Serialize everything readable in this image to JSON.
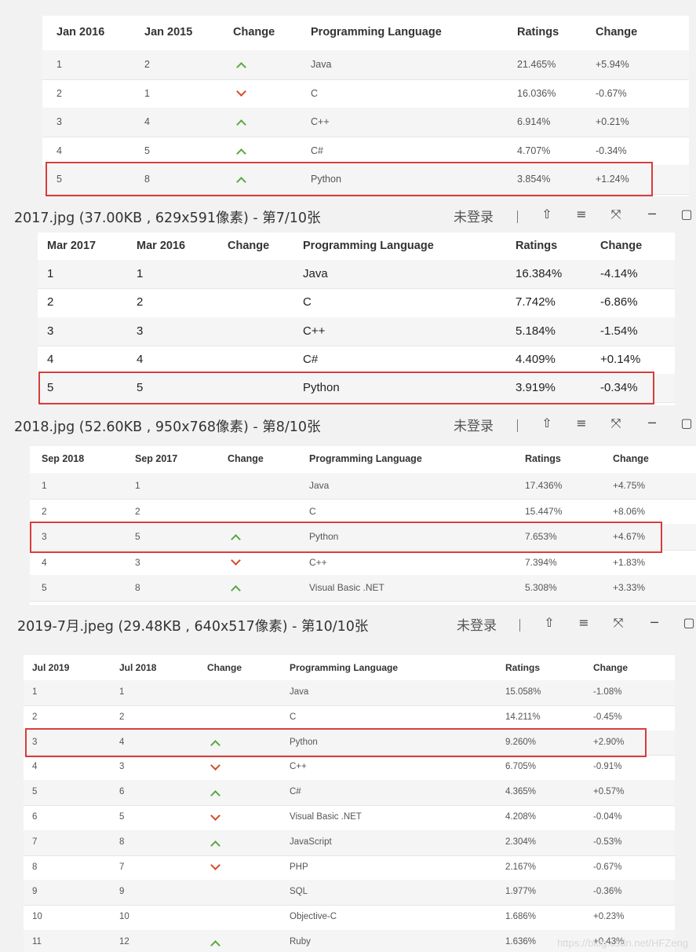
{
  "windows": [
    {
      "title": null,
      "table": {
        "headers": [
          "Jan 2016",
          "Jan 2015",
          "Change",
          "Programming Language",
          "Ratings",
          "Change"
        ],
        "rows": [
          {
            "rank": "1",
            "prev": "2",
            "trend": "up",
            "lang": "Java",
            "rating": "21.465%",
            "change": "+5.94%"
          },
          {
            "rank": "2",
            "prev": "1",
            "trend": "down",
            "lang": "C",
            "rating": "16.036%",
            "change": "-0.67%"
          },
          {
            "rank": "3",
            "prev": "4",
            "trend": "up",
            "lang": "C++",
            "rating": "6.914%",
            "change": "+0.21%"
          },
          {
            "rank": "4",
            "prev": "5",
            "trend": "up",
            "lang": "C#",
            "rating": "4.707%",
            "change": "-0.34%"
          },
          {
            "rank": "5",
            "prev": "8",
            "trend": "up",
            "lang": "Python",
            "rating": "3.854%",
            "change": "+1.24%"
          }
        ],
        "highlighted_row": 4
      }
    },
    {
      "title": "2017.jpg (37.00KB , 629x591像素) - 第7/10张",
      "login": "未登录",
      "table": {
        "headers": [
          "Mar 2017",
          "Mar 2016",
          "Change",
          "Programming Language",
          "Ratings",
          "Change"
        ],
        "rows": [
          {
            "rank": "1",
            "prev": "1",
            "trend": "",
            "lang": "Java",
            "rating": "16.384%",
            "change": "-4.14%"
          },
          {
            "rank": "2",
            "prev": "2",
            "trend": "",
            "lang": "C",
            "rating": "7.742%",
            "change": "-6.86%"
          },
          {
            "rank": "3",
            "prev": "3",
            "trend": "",
            "lang": "C++",
            "rating": "5.184%",
            "change": "-1.54%"
          },
          {
            "rank": "4",
            "prev": "4",
            "trend": "",
            "lang": "C#",
            "rating": "4.409%",
            "change": "+0.14%"
          },
          {
            "rank": "5",
            "prev": "5",
            "trend": "",
            "lang": "Python",
            "rating": "3.919%",
            "change": "-0.34%"
          }
        ],
        "highlighted_row": 4
      }
    },
    {
      "title": "2018.jpg (52.60KB , 950x768像素) - 第8/10张",
      "login": "未登录",
      "table": {
        "headers": [
          "Sep 2018",
          "Sep 2017",
          "Change",
          "Programming Language",
          "Ratings",
          "Change"
        ],
        "rows": [
          {
            "rank": "1",
            "prev": "1",
            "trend": "",
            "lang": "Java",
            "rating": "17.436%",
            "change": "+4.75%"
          },
          {
            "rank": "2",
            "prev": "2",
            "trend": "",
            "lang": "C",
            "rating": "15.447%",
            "change": "+8.06%"
          },
          {
            "rank": "3",
            "prev": "5",
            "trend": "up",
            "lang": "Python",
            "rating": "7.653%",
            "change": "+4.67%"
          },
          {
            "rank": "4",
            "prev": "3",
            "trend": "down",
            "lang": "C++",
            "rating": "7.394%",
            "change": "+1.83%"
          },
          {
            "rank": "5",
            "prev": "8",
            "trend": "up",
            "lang": "Visual Basic .NET",
            "rating": "5.308%",
            "change": "+3.33%"
          }
        ],
        "highlighted_row": 2
      }
    },
    {
      "title": "2019-7月.jpeg (29.48KB , 640x517像素) - 第10/10张",
      "login": "未登录",
      "table": {
        "headers": [
          "Jul 2019",
          "Jul 2018",
          "Change",
          "Programming Language",
          "Ratings",
          "Change"
        ],
        "rows": [
          {
            "rank": "1",
            "prev": "1",
            "trend": "",
            "lang": "Java",
            "rating": "15.058%",
            "change": "-1.08%"
          },
          {
            "rank": "2",
            "prev": "2",
            "trend": "",
            "lang": "C",
            "rating": "14.211%",
            "change": "-0.45%"
          },
          {
            "rank": "3",
            "prev": "4",
            "trend": "up",
            "lang": "Python",
            "rating": "9.260%",
            "change": "+2.90%"
          },
          {
            "rank": "4",
            "prev": "3",
            "trend": "down",
            "lang": "C++",
            "rating": "6.705%",
            "change": "-0.91%"
          },
          {
            "rank": "5",
            "prev": "6",
            "trend": "up",
            "lang": "C#",
            "rating": "4.365%",
            "change": "+0.57%"
          },
          {
            "rank": "6",
            "prev": "5",
            "trend": "down",
            "lang": "Visual Basic .NET",
            "rating": "4.208%",
            "change": "-0.04%"
          },
          {
            "rank": "7",
            "prev": "8",
            "trend": "up",
            "lang": "JavaScript",
            "rating": "2.304%",
            "change": "-0.53%"
          },
          {
            "rank": "8",
            "prev": "7",
            "trend": "down",
            "lang": "PHP",
            "rating": "2.167%",
            "change": "-0.67%"
          },
          {
            "rank": "9",
            "prev": "9",
            "trend": "",
            "lang": "SQL",
            "rating": "1.977%",
            "change": "-0.36%"
          },
          {
            "rank": "10",
            "prev": "10",
            "trend": "",
            "lang": "Objective-C",
            "rating": "1.686%",
            "change": "+0.23%"
          },
          {
            "rank": "11",
            "prev": "12",
            "trend": "up",
            "lang": "Ruby",
            "rating": "1.636%",
            "change": "+0.43%"
          }
        ],
        "highlighted_row": 2
      },
      "watermark": "https://blog.csdn.net/HFZeng"
    }
  ],
  "toolbar_icons": [
    "pin-icon",
    "menu-icon",
    "fullscreen-icon",
    "minimize-icon",
    "maximize-icon"
  ],
  "colors": {
    "highlight": "#d93c3c",
    "up": "#5aa840",
    "down": "#d64a2a"
  }
}
